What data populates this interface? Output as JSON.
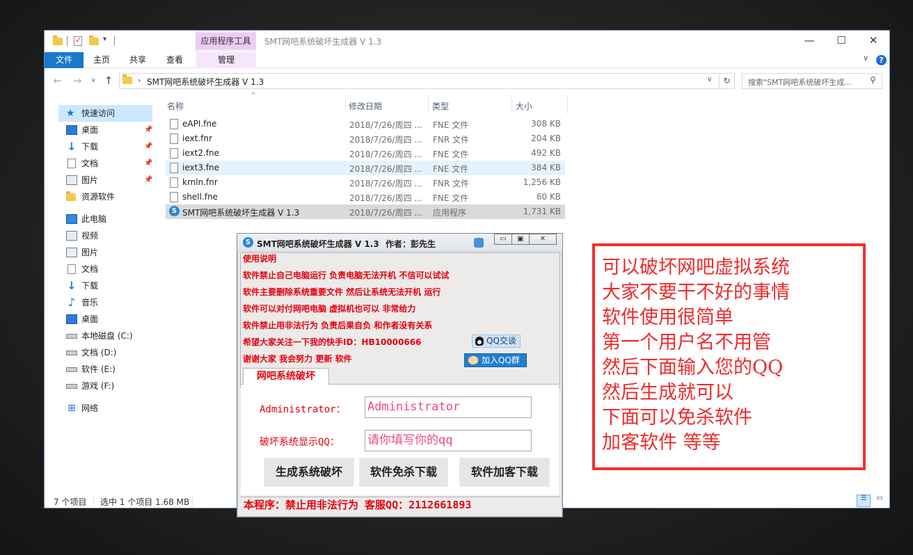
{
  "explorer": {
    "title": "SMT网吧系统破坏生成器 V 1.3",
    "context_tab_group": "应用程序工具",
    "ribbon_tabs": [
      "文件",
      "主页",
      "共享",
      "查看",
      "管理"
    ],
    "window_controls": [
      "minimize-icon",
      "maximize-icon",
      "close-icon"
    ],
    "address": "SMT网吧系统破坏生成器 V 1.3",
    "search_placeholder": "搜索\"SMT网吧系统破坏生成...",
    "nav": {
      "quick_access": "快速访问",
      "quick_items": [
        "桌面",
        "下载",
        "文档",
        "图片",
        "资源软件"
      ],
      "this_pc": "此电脑",
      "pc_items": [
        "视频",
        "图片",
        "文档",
        "下载",
        "音乐",
        "桌面",
        "本地磁盘 (C:)",
        "文档 (D:)",
        "软件 (E:)",
        "游戏 (F:)"
      ],
      "network": "网络"
    },
    "columns": {
      "name": "名称",
      "date": "修改日期",
      "type": "类型",
      "size": "大小"
    },
    "files": [
      {
        "name": "eAPI.fne",
        "date": "2018/7/26/周四 ...",
        "type": "FNE 文件",
        "size": "308 KB"
      },
      {
        "name": "iext.fnr",
        "date": "2018/7/26/周四 ...",
        "type": "FNR 文件",
        "size": "204 KB"
      },
      {
        "name": "iext2.fne",
        "date": "2018/7/26/周四 ...",
        "type": "FNE 文件",
        "size": "492 KB"
      },
      {
        "name": "iext3.fne",
        "date": "2018/7/26/周四 ...",
        "type": "FNE 文件",
        "size": "384 KB"
      },
      {
        "name": "krnln.fnr",
        "date": "2018/7/26/周四 ...",
        "type": "FNR 文件",
        "size": "1,256 KB"
      },
      {
        "name": "shell.fne",
        "date": "2018/7/26/周四 ...",
        "type": "FNE 文件",
        "size": "60 KB"
      },
      {
        "name": "SMT网吧系统破坏生成器 V 1.3",
        "date": "2018/7/26/周四 ...",
        "type": "应用程序",
        "size": "1,731 KB"
      }
    ],
    "status_count": "7 个项目",
    "status_selection": "选中 1 个项目  1.68 MB"
  },
  "dialog": {
    "title": "SMT网吧系统破坏生成器 V 1.3",
    "author": "作者：彭先生",
    "info_lines": [
      "使用说明",
      "软件禁止自己电脑运行 负责电脑无法开机 不信可以试试",
      "软件主要删除系统重要文件 然后让系统无法开机 运行",
      "软件可以对付网吧电脑 虚拟机也可以 非常给力",
      "软件禁止用非法行为 负责后果自负 和作者没有关系",
      "希望大家关注一下我的快手ID：HB10000666",
      "谢谢大家 我会努力  更新 软件"
    ],
    "qq_chat": "QQ交谈",
    "qq_group": "加入QQ群",
    "tab": "网吧系统破坏",
    "form": {
      "user_label": "Administrator：",
      "user_value": "Administrator",
      "qq_label": "破坏系统显示QQ：",
      "qq_value": "请你填写你的qq"
    },
    "buttons": [
      "生成系统破坏",
      "软件免杀下载",
      "软件加客下载"
    ],
    "footer": "本程序：禁止用非法行为 客服QQ：2112661893"
  },
  "note": {
    "lines": [
      "可以破坏网吧虚拟系统",
      "大家不要干不好的事情",
      "软件使用很简单",
      "第一个用户名不用管",
      "然后下面输入您的QQ",
      "然后生成就可以",
      "下面可以免杀软件",
      "加客软件 等等"
    ]
  },
  "colors": {
    "accent": "#1979ca",
    "warning_text": "#e8000c",
    "note_border": "#f03030"
  }
}
